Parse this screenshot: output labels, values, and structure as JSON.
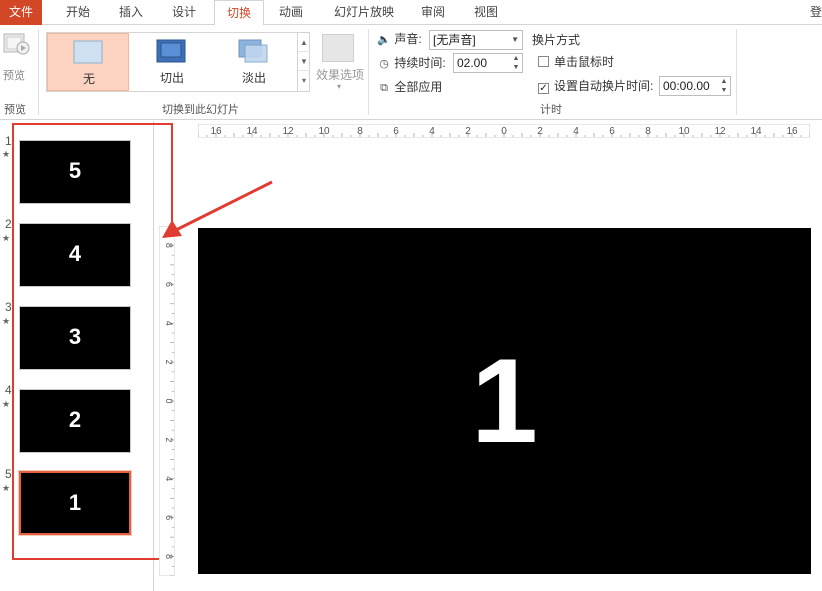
{
  "tabs": [
    {
      "label": "文件",
      "kind": "file"
    },
    {
      "label": "开始"
    },
    {
      "label": "插入"
    },
    {
      "label": "设计"
    },
    {
      "label": "切换",
      "active": true
    },
    {
      "label": "动画"
    },
    {
      "label": "幻灯片放映"
    },
    {
      "label": "审阅"
    },
    {
      "label": "视图"
    }
  ],
  "tab_right": "登",
  "ribbon": {
    "preview_label": "预览",
    "preview_group_label": "预览",
    "transitions": [
      {
        "label": "无",
        "selected": true
      },
      {
        "label": "切出"
      },
      {
        "label": "淡出"
      }
    ],
    "effect_options_label": "效果选项",
    "transitions_group_label": "切换到此幻灯片",
    "sound_label": "声音:",
    "sound_value": "[无声音]",
    "duration_label": "持续时间:",
    "duration_value": "02.00",
    "apply_all_label": "全部应用",
    "advance_title": "换片方式",
    "on_click_label": "单击鼠标时",
    "on_click_checked": false,
    "auto_after_label": "设置自动换片时间:",
    "auto_after_checked": true,
    "auto_after_value": "00:00.00",
    "timing_group_label": "计时"
  },
  "slides": [
    {
      "number": "1",
      "title": "5"
    },
    {
      "number": "2",
      "title": "4"
    },
    {
      "number": "3",
      "title": "3"
    },
    {
      "number": "4",
      "title": "2"
    },
    {
      "number": "5",
      "title": "1",
      "current": true
    }
  ],
  "hruler_labels": [
    "16",
    "14",
    "12",
    "10",
    "8",
    "6",
    "4",
    "2",
    "0",
    "2",
    "4",
    "6",
    "8",
    "10",
    "12",
    "14",
    "16"
  ],
  "vruler_labels": [
    "8",
    "6",
    "4",
    "2",
    "0",
    "2",
    "4",
    "6",
    "8"
  ],
  "main_slide_text": "1",
  "colors": {
    "accent": "#d24726",
    "selected_transition_bg": "#fbd3c0",
    "annotation_red": "#e03c31",
    "slide_bg": "#000000"
  }
}
